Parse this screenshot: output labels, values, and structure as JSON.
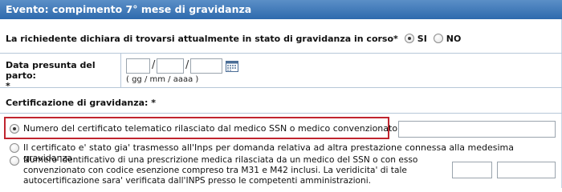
{
  "header": {
    "title": "Evento: compimento 7° mese di gravidanza"
  },
  "pregnancy": {
    "question": "La richiedente dichiara di trovarsi attualmente in stato di gravidanza in corso*",
    "yes_label": "SI",
    "no_label": "NO",
    "selected": "SI"
  },
  "due_date": {
    "label": "Data presunta del parto:",
    "required_mark": "*",
    "day": "",
    "month": "",
    "year": "",
    "format_hint": "( gg  /  mm  /  aaaa )",
    "separator": "/"
  },
  "certification": {
    "label": "Certificazione di gravidanza: *",
    "options": [
      {
        "text": "Numero del certificato telematico rilasciato dal medico SSN o medico convenzionato ASL",
        "selected": true
      },
      {
        "text": "Il certificato e' stato gia' trasmesso all'Inps per domanda relativa ad altra prestazione connessa alla medesima gravidanza",
        "selected": false
      },
      {
        "text": "Numero identificativo di una prescrizione medica rilasciata da un medico del SSN o con esso convenzionato con codice esenzione compreso tra M31 e M42 inclusi. La veridicita' di tale autocertificazione sara' verificata dall'INPS presso le competenti amministrazioni.",
        "selected": false
      }
    ],
    "certificate_number": "",
    "prescription_part1": "",
    "prescription_part2": ""
  },
  "colors": {
    "header_top": "#5b8fc7",
    "header_bottom": "#2e6aad",
    "highlight": "#c0252f"
  },
  "icons": {
    "calendar": "calendar-icon"
  }
}
